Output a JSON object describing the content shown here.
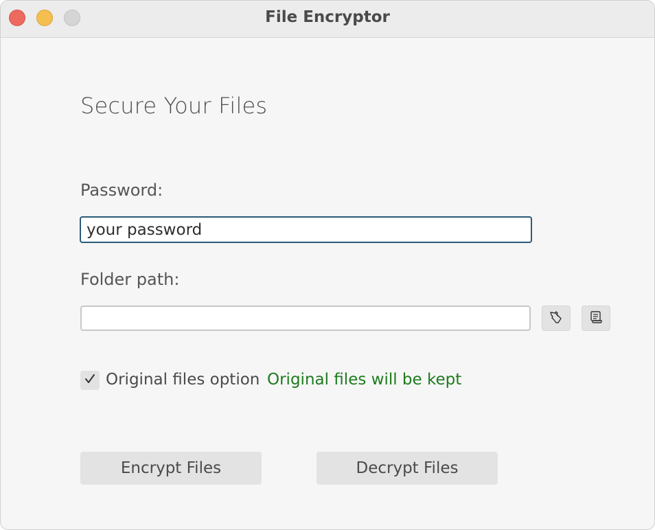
{
  "window": {
    "title": "File Encryptor"
  },
  "main": {
    "heading": "Secure Your Files",
    "password": {
      "label": "Password:",
      "value": "your password"
    },
    "folder": {
      "label": "Folder path:",
      "value": "",
      "browse_icon": "hand-pointer-icon",
      "scroll_icon": "scroll-icon"
    },
    "original_files": {
      "checked": true,
      "label": "Original files option",
      "status": "Original files will be kept",
      "status_color": "#1e7a1e"
    },
    "buttons": {
      "encrypt": "Encrypt Files",
      "decrypt": "Decrypt Files"
    }
  }
}
